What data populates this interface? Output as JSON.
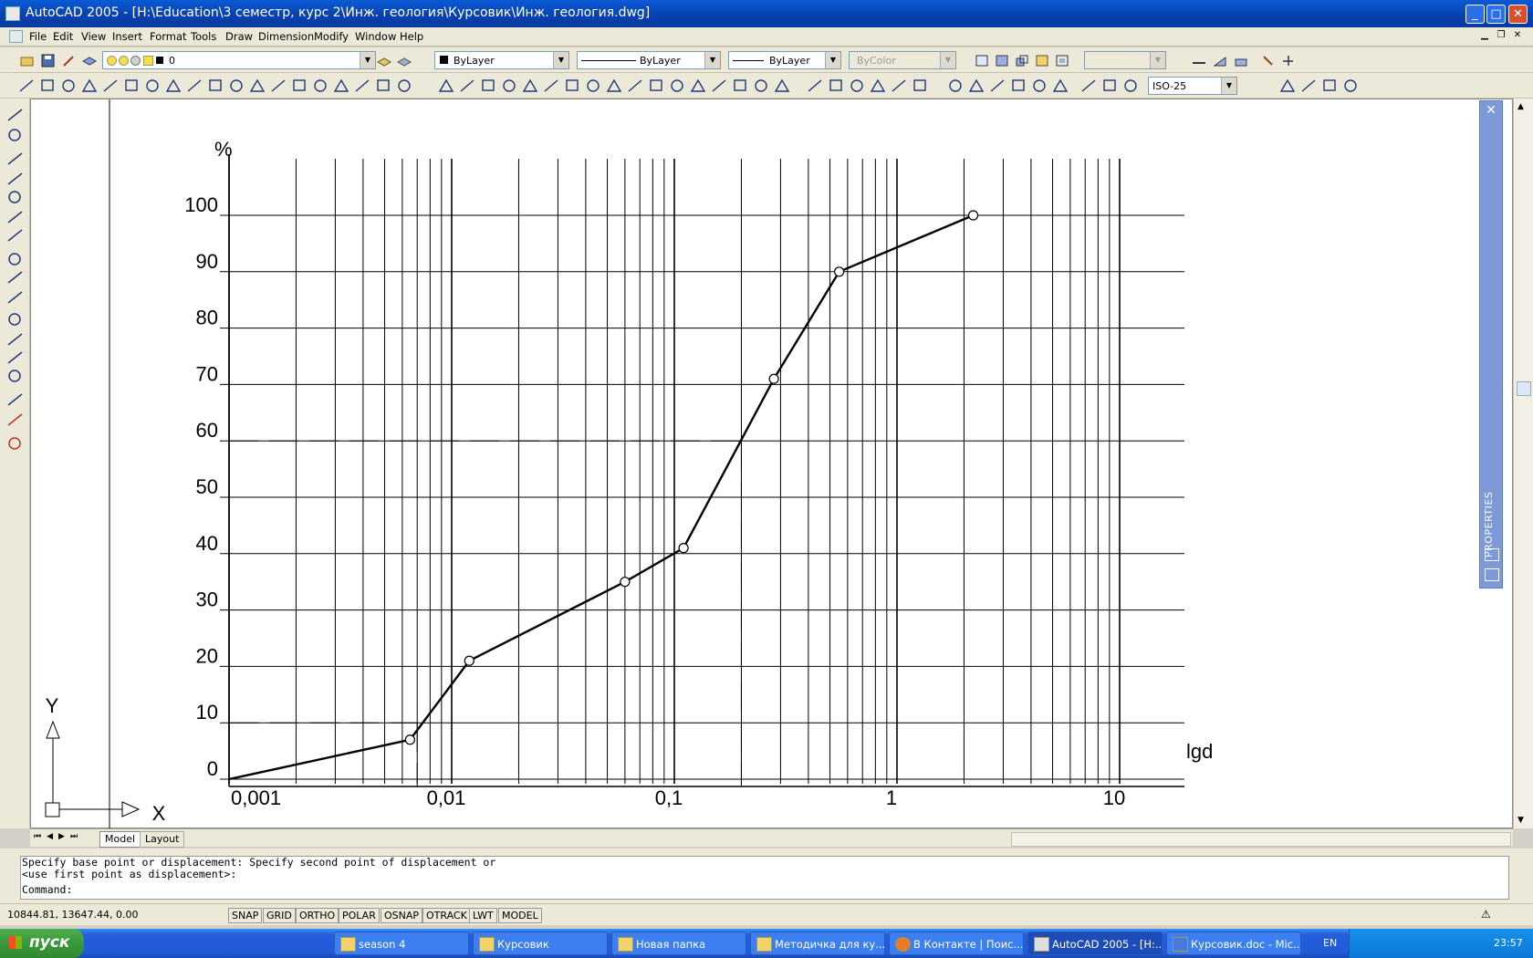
{
  "window": {
    "title": "AutoCAD 2005 - [H:\\Education\\3 семестр, курс 2\\Инж. геология\\Курсовик\\Инж. геология.dwg]",
    "controls": [
      "_",
      "□",
      "✕"
    ]
  },
  "menu": {
    "items": [
      "File",
      "Edit",
      "View",
      "Insert",
      "Format",
      "Tools",
      "Draw",
      "Dimension",
      "Modify",
      "Window",
      "Help"
    ]
  },
  "toolbar": {
    "layer_value": "0",
    "color_value": "ByLayer",
    "linetype_value": "ByLayer",
    "lineweight_value": "ByLayer",
    "plotstyle_value": "ByColor",
    "dimstyle_value": "ISO-25"
  },
  "drawing": {
    "y_axis_label": "%",
    "x_axis_label": "lgd",
    "y_ticks": [
      "100",
      "90",
      "80",
      "70",
      "60",
      "50",
      "40",
      "30",
      "20",
      "10",
      "0"
    ],
    "x_ticks": [
      "0,001",
      "0,01",
      "0,1",
      "1",
      "10"
    ],
    "ucs_x": "X",
    "ucs_y": "Y"
  },
  "chart_data": {
    "type": "line",
    "x_scale": "log",
    "xlim": [
      0.001,
      15
    ],
    "ylim": [
      0,
      100
    ],
    "x_tick_labels": [
      "0,001",
      "0,01",
      "0,1",
      "1",
      "10"
    ],
    "y_tick_labels": [
      "0",
      "10",
      "20",
      "30",
      "40",
      "50",
      "60",
      "70",
      "80",
      "90",
      "100"
    ],
    "ylabel": "%",
    "xlabel": "lgd",
    "grid": true,
    "series": [
      {
        "points": [
          [
            0.001,
            0
          ],
          [
            0.0065,
            7
          ],
          [
            0.012,
            21
          ],
          [
            0.06,
            35
          ],
          [
            0.11,
            41
          ],
          [
            0.28,
            71
          ],
          [
            0.55,
            90
          ],
          [
            2.2,
            100
          ]
        ]
      }
    ],
    "guide_lines": [
      {
        "y": 10,
        "x": 0.007
      },
      {
        "y": 60,
        "x": 0.2
      }
    ]
  },
  "props_palette": {
    "label": "PROPERTIES"
  },
  "tabs": [
    "Model",
    "Layout"
  ],
  "command": {
    "history": [
      "Specify base point or displacement: Specify second point of displacement or",
      "<use first point as displacement>:"
    ],
    "prompt": "Command:"
  },
  "status": {
    "coords": "10844.81, 13647.44, 0.00",
    "buttons": [
      "SNAP",
      "GRID",
      "ORTHO",
      "POLAR",
      "OSNAP",
      "OTRACK",
      "LWT",
      "MODEL"
    ]
  },
  "taskbar": {
    "start": "пуск",
    "tasks": [
      "season 4",
      "Курсовик",
      "Новая папка",
      "Методичка для ку...",
      "В Контакте | Поис...",
      "AutoCAD 2005 - [H:...",
      "Курсовик.doc - Mic..."
    ],
    "lang": "EN",
    "time": "23:57"
  },
  "colors": {
    "titlebar": "#0842b0",
    "taskbar": "#245edc",
    "start": "#3b9a3b",
    "props": "#7d99d8"
  }
}
